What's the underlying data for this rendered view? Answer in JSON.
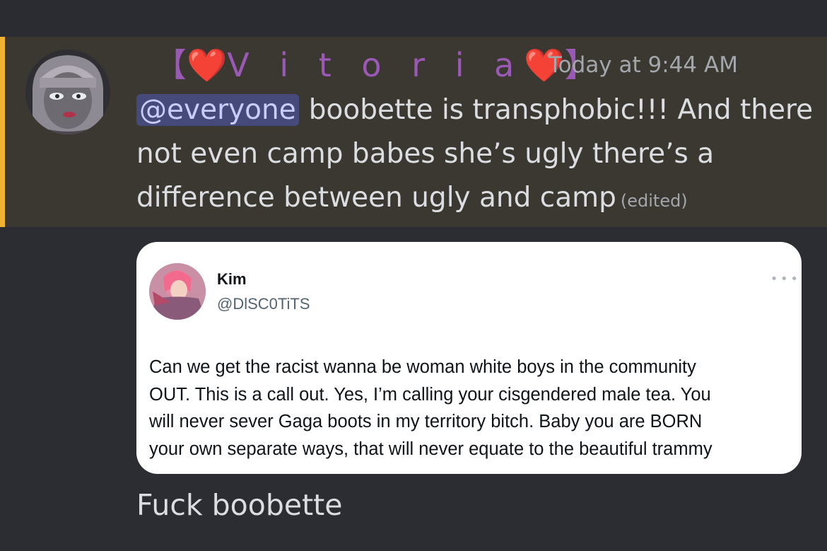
{
  "message": {
    "author_display": {
      "open_bracket": "【",
      "heart_left": "❤️",
      "name_letters": "V i t o r i a",
      "heart_right": "❤️",
      "close_bracket": "】"
    },
    "timestamp": "Today at 9:44 AM",
    "mention": "@everyone",
    "body": "boobette is transphobic!!! And there  not even camp babes she’s ugly there’s a difference between ugly and camp",
    "edited_label": "(edited)",
    "colors": {
      "username": "#9b59b6",
      "mention_bar": "#f0b232",
      "highlight_bg": "#3b3832",
      "mention_bg": "#454a7a"
    }
  },
  "embed_tweet": {
    "name": "Kim",
    "handle": "@DlSC0TiTS",
    "more_icon": "ellipsis-icon",
    "text_lines": [
      "Can we get the racist wanna be woman white boys in the community",
      "OUT. This is a call out. Yes, I’m calling your cisgendered male tea. You",
      "will never sever Gaga boots in my territory bitch. Baby you are BORN",
      "your own separate ways, that will never equate to the beautiful trammy"
    ]
  },
  "followup_message": "Fuck boobette"
}
